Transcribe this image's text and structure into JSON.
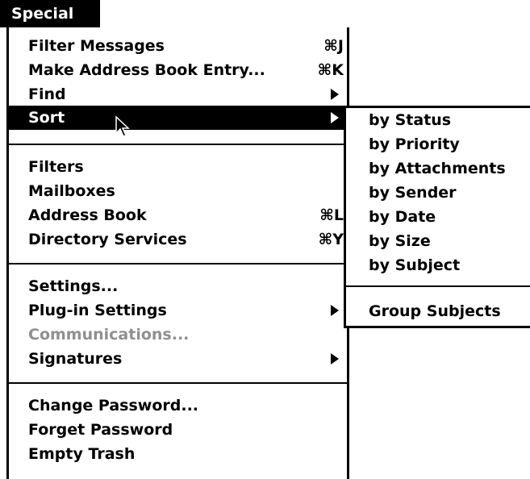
{
  "menu_title": "Special",
  "menu": {
    "groups": [
      {
        "items": [
          {
            "label": "Filter Messages",
            "shortcut": "⌘J"
          },
          {
            "label": "Make Address Book Entry...",
            "shortcut": "⌘K"
          },
          {
            "label": "Find"
          },
          {
            "label": "Sort"
          }
        ]
      },
      {
        "items": [
          {
            "label": "Filters"
          },
          {
            "label": "Mailboxes"
          },
          {
            "label": "Address Book",
            "shortcut": "⌘L"
          },
          {
            "label": "Directory Services",
            "shortcut": "⌘Y"
          }
        ]
      },
      {
        "items": [
          {
            "label": "Settings..."
          },
          {
            "label": "Plug-in Settings"
          },
          {
            "label": "Communications..."
          },
          {
            "label": "Signatures"
          }
        ]
      },
      {
        "items": [
          {
            "label": "Change Password..."
          },
          {
            "label": "Forget Password"
          },
          {
            "label": "Empty Trash"
          }
        ]
      }
    ]
  },
  "sort_submenu": {
    "items": [
      {
        "label": "by Status"
      },
      {
        "label": "by Priority"
      },
      {
        "label": "by Attachments"
      },
      {
        "label": "by Sender"
      },
      {
        "label": "by Date"
      },
      {
        "label": "by Size"
      },
      {
        "label": "by Subject"
      },
      {
        "label": "Group Subjects"
      }
    ]
  }
}
